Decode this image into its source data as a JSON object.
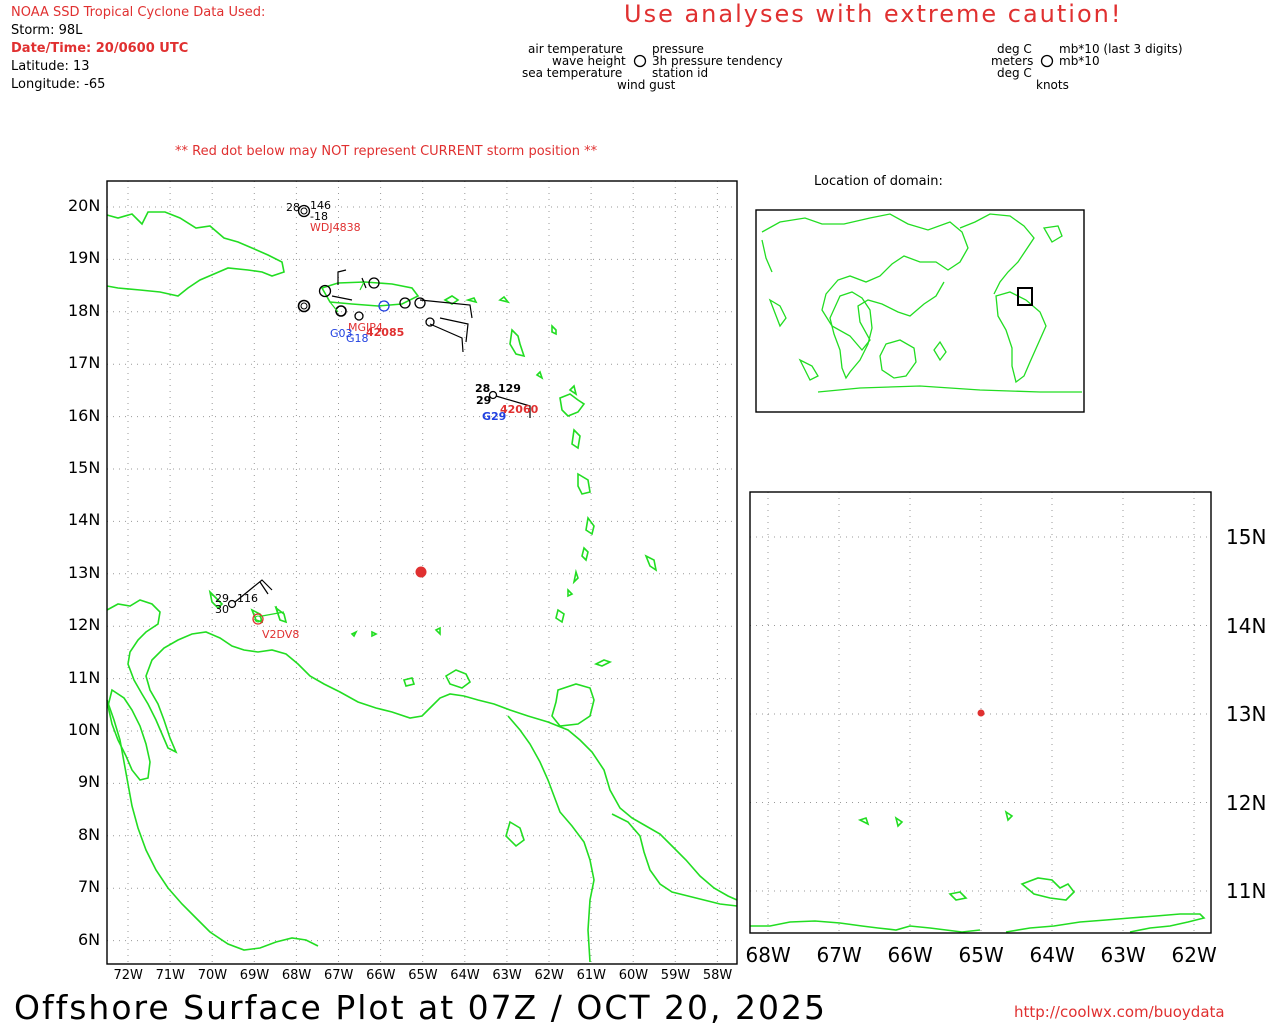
{
  "header": {
    "source_title": "NOAA SSD Tropical Cyclone Data Used:",
    "storm": "Storm: 98L",
    "datetime": "Date/Time: 20/0600 UTC",
    "latitude": "Latitude: 13",
    "longitude": "Longitude: -65",
    "caution": "Use analyses with extreme caution!",
    "red_dot_note": "** Red dot below may NOT represent CURRENT storm position **"
  },
  "legend": {
    "air_temperature": "air temperature",
    "wave_height": "wave height",
    "sea_temperature": "sea temperature",
    "wind_gust": "wind gust",
    "pressure": "pressure",
    "pressure_tendency": "3h pressure tendency",
    "station_id": "station id",
    "unit_deg_c_top": "deg C",
    "unit_meters": "meters",
    "unit_deg_c_bottom": "deg C",
    "unit_knots": "knots",
    "unit_mb_last3": "mb*10 (last 3 digits)",
    "unit_mb": "mb*10"
  },
  "inset_title": "Location of domain:",
  "main_map": {
    "lat_labels": [
      "20N",
      "19N",
      "18N",
      "17N",
      "16N",
      "15N",
      "14N",
      "13N",
      "12N",
      "11N",
      "10N",
      "9N",
      "8N",
      "7N",
      "6N"
    ],
    "lon_labels": [
      "72W",
      "71W",
      "70W",
      "69W",
      "68W",
      "67W",
      "66W",
      "65W",
      "64W",
      "63W",
      "62W",
      "61W",
      "60W",
      "59W",
      "58W"
    ],
    "storm_position": {
      "lat": 13,
      "lon": -65
    },
    "stations": [
      {
        "id": "WDJ4838",
        "air": "28",
        "pressure": "146",
        "tendency": "-18"
      },
      {
        "id": "42060",
        "air": "28",
        "pressure": "129",
        "sea": "29"
      },
      {
        "id": "G29",
        "air": "",
        "pressure": ""
      },
      {
        "id": "V2DV8",
        "air": "29",
        "pressure": "116",
        "sea": "30"
      },
      {
        "id": "MGIP4",
        "air": "",
        "pressure": ""
      },
      {
        "id": "42085",
        "air": "",
        "pressure": ""
      },
      {
        "id": "G03",
        "air": "",
        "pressure": ""
      },
      {
        "id": "G18",
        "air": "",
        "pressure": ""
      }
    ]
  },
  "zoom_map": {
    "lat_labels": [
      "15N",
      "14N",
      "13N",
      "12N",
      "11N"
    ],
    "lon_labels": [
      "68W",
      "67W",
      "66W",
      "65W",
      "64W",
      "63W",
      "62W"
    ]
  },
  "footer": {
    "title": "Offshore Surface Plot at 07Z / OCT 20, 2025",
    "url": "http://coolwx.com/buoydata"
  },
  "colors": {
    "land": "#22dd22",
    "accent": "#e03030",
    "station_id_blue": "#2040e0",
    "grid": "#999999"
  }
}
